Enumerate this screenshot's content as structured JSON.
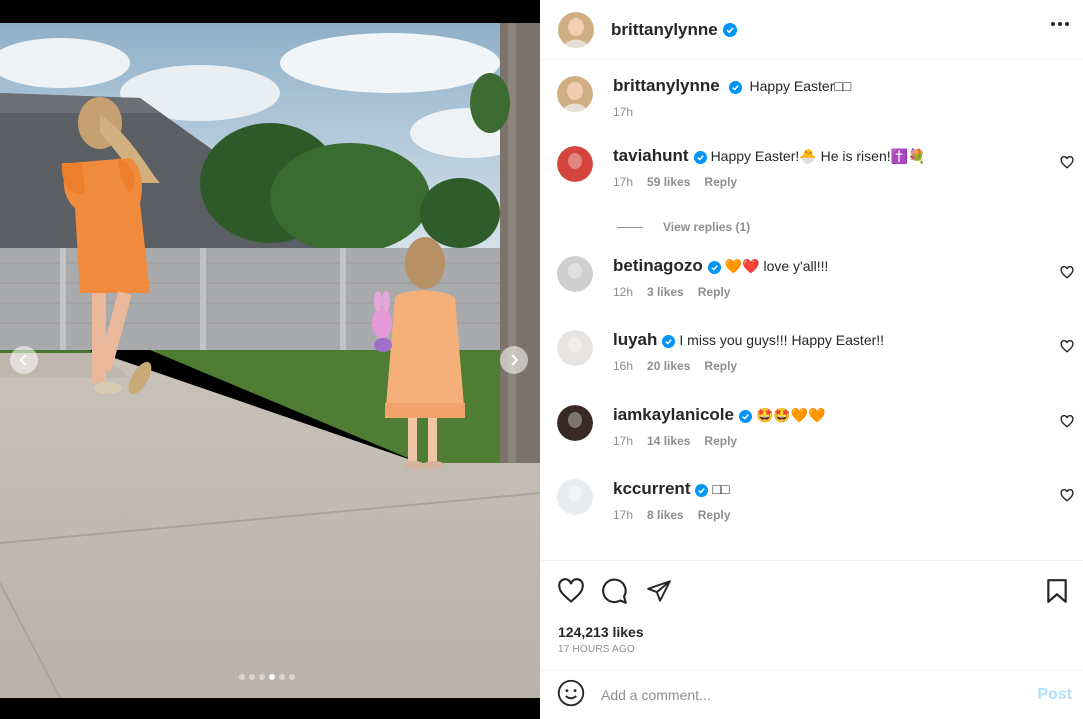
{
  "post": {
    "author": "brittanylynne",
    "caption_user": "brittanylynne",
    "caption_text": "Happy Easter□□",
    "caption_time": "17h",
    "likes": "124,213 likes",
    "time_ago": "17 HOURS AGO"
  },
  "carousel": {
    "total": 6,
    "active_index": 3
  },
  "comments": [
    {
      "user": "taviahunt",
      "text": "Happy Easter!🐣 He is risen!✝️💐",
      "time": "17h",
      "likes": "59 likes",
      "reply": "Reply",
      "avatar_color": "#d4453f"
    },
    {
      "user": "betinagozo",
      "text": "🧡❤️ love y'all!!!",
      "time": "12h",
      "likes": "3 likes",
      "reply": "Reply",
      "avatar_color": "#cfcfcf"
    },
    {
      "user": "luyah",
      "text": "I miss you guys!!! Happy Easter!!",
      "time": "16h",
      "likes": "20 likes",
      "reply": "Reply",
      "avatar_color": "#e8e4e2"
    },
    {
      "user": "iamkaylanicole",
      "text": "🤩🤩🧡🧡",
      "time": "17h",
      "likes": "14 likes",
      "reply": "Reply",
      "avatar_color": "#3a2a24"
    },
    {
      "user": "kccurrent",
      "text": "□□",
      "time": "17h",
      "likes": "8 likes",
      "reply": "Reply",
      "avatar_color": "#e9ecef"
    }
  ],
  "view_replies": "View replies (1)",
  "add_comment": {
    "placeholder": "Add a comment...",
    "post_label": "Post"
  },
  "colors": {
    "verified": "#0095f6",
    "post_disabled": "#b2dffc",
    "dress": "#f08a3c",
    "toddler_dress": "#f5b07a"
  }
}
